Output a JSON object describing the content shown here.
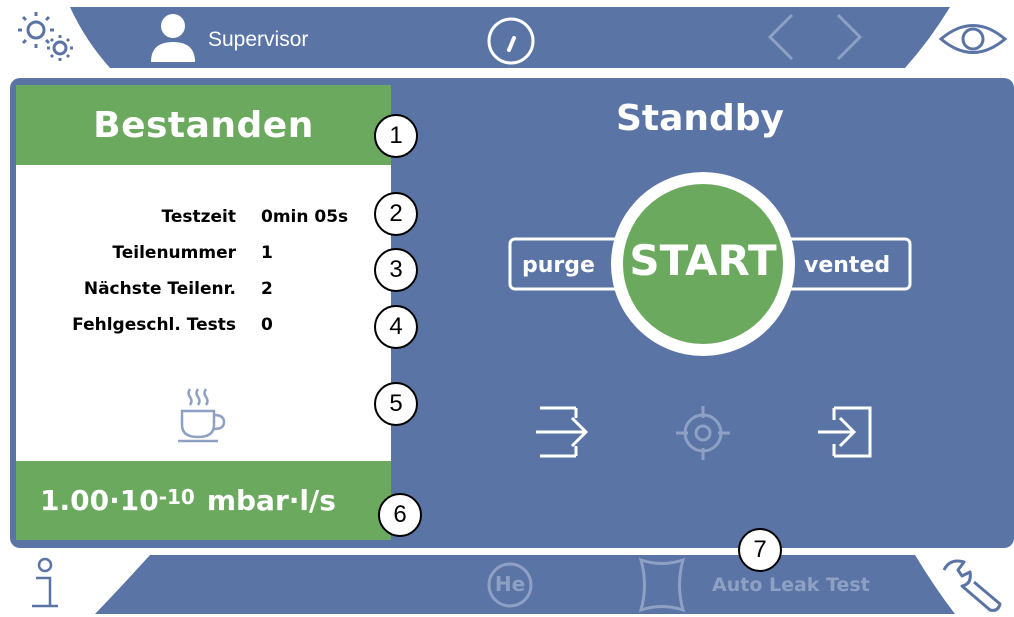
{
  "colors": {
    "bar_blue": "#5a74a5",
    "success_green": "#6baa5e",
    "icon_blue": "#8ea0c4"
  },
  "topbar": {
    "settings_icon": "gears-icon",
    "user_icon": "user-icon",
    "user_name": "Supervisor",
    "timer_icon": "gauge-icon",
    "prev_icon": "chevron-left-icon",
    "next_icon": "chevron-right-icon",
    "view_icon": "eye-icon"
  },
  "result": {
    "status": "Bestanden",
    "fields": [
      {
        "label": "Testzeit",
        "value": "0min 05s"
      },
      {
        "label": "Teilenummer",
        "value": "1"
      },
      {
        "label": "Nächste Teilenr.",
        "value": "2"
      },
      {
        "label": "Fehlgeschl. Tests",
        "value": "0"
      }
    ],
    "idle_icon": "coffee-cup-icon",
    "leak_rate_mantissa": "1.00·10",
    "leak_rate_exponent": "-10",
    "leak_rate_unit": "mbar·l/s"
  },
  "control": {
    "state": "Standby",
    "left_label": "purge",
    "start_label": "START",
    "right_label": "vented",
    "icons": [
      "exit-arrow-icon",
      "crosshair-icon",
      "enter-arrow-icon"
    ]
  },
  "bottombar": {
    "info_icon": "info-icon",
    "gas_label": "He",
    "mode_icon": "test-chamber-icon",
    "mode_label": "Auto Leak Test",
    "tools_icon": "wrench-icon"
  },
  "callouts": [
    "1",
    "2",
    "3",
    "4",
    "5",
    "6",
    "7"
  ]
}
